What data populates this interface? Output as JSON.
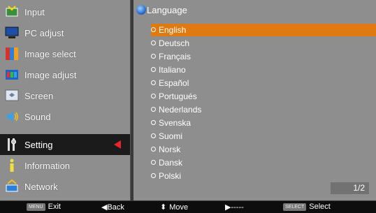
{
  "menu": {
    "items": [
      {
        "label": "Input",
        "icon": "input-icon"
      },
      {
        "label": "PC adjust",
        "icon": "pc-adjust-icon"
      },
      {
        "label": "Image select",
        "icon": "image-select-icon"
      },
      {
        "label": "Image adjust",
        "icon": "image-adjust-icon"
      },
      {
        "label": "Screen",
        "icon": "screen-icon"
      },
      {
        "label": "Sound",
        "icon": "sound-icon"
      },
      {
        "label": "Setting",
        "icon": "setting-icon"
      },
      {
        "label": "Information",
        "icon": "information-icon"
      },
      {
        "label": "Network",
        "icon": "network-icon"
      }
    ],
    "selected_index": 6
  },
  "submenu": {
    "title": "Language",
    "languages": [
      "English",
      "Deutsch",
      "Français",
      "Italiano",
      "Español",
      "Portugués",
      "Nederlands",
      "Svenska",
      "Suomi",
      "Norsk",
      "Dansk",
      "Polski"
    ],
    "active_index": 0,
    "page": "1/2"
  },
  "bottom_bar": {
    "exit_key": "MENU",
    "exit_label": "Exit",
    "back_label": "◀Back",
    "move_label": "Move",
    "next_label": "▶-----",
    "select_key": "SELECT",
    "select_label": "Select"
  },
  "colors": {
    "panel": "#8e8e8e",
    "selected_row": "#1b1b1b",
    "highlight": "#e07a10",
    "arrow": "#e8262a"
  }
}
